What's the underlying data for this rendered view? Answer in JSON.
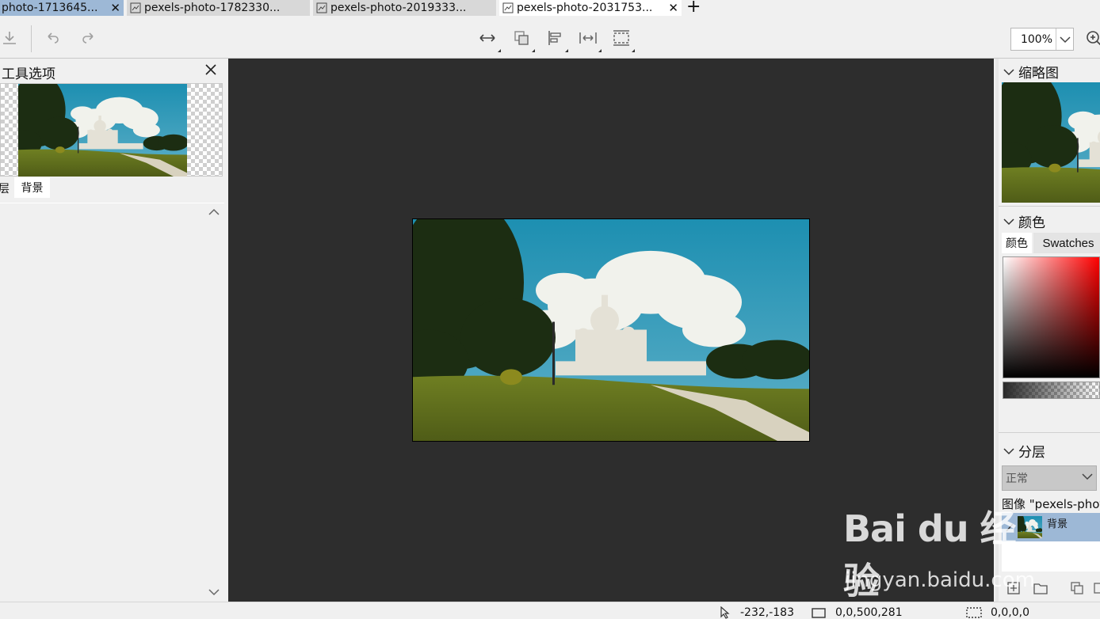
{
  "tabs": [
    {
      "label": "photo-1713645...",
      "active": false,
      "selected_bg": "#9db8d6"
    },
    {
      "label": "pexels-photo-1782330..."
    },
    {
      "label": "pexels-photo-2019333..."
    },
    {
      "label": "pexels-photo-2031753...",
      "active": true
    }
  ],
  "toolbar": {
    "zoom_value": "100%",
    "icons": [
      "save-icon",
      "undo-icon",
      "redo-icon",
      "flip-horizontal-icon",
      "merge-layers-icon",
      "align-icon",
      "distribute-icon",
      "transform-icon",
      "zoom-in-icon"
    ]
  },
  "left_panel": {
    "title": "工具选项",
    "tab_partial": "层",
    "tab_active": "背景"
  },
  "right_panel": {
    "thumbnail_title": "缩略图",
    "color_title": "颜色",
    "color_tab1": "颜色",
    "color_tab2": "Swatches",
    "layers_title": "分层",
    "blend_mode": "正常",
    "image_label": "图像 \"pexels-phot",
    "layer_name": "背景"
  },
  "status": {
    "cursor": "-232,-183",
    "image_rect": "0,0,500,281",
    "selection": "0,0,0,0"
  },
  "watermark": {
    "main": "Bai du 经验",
    "sub": "jingyan.baidu.com"
  },
  "colors": {
    "canvas_bg": "#2d2d2d",
    "selected_row": "#9db8d6",
    "panel_bg": "#f0f0f0"
  }
}
